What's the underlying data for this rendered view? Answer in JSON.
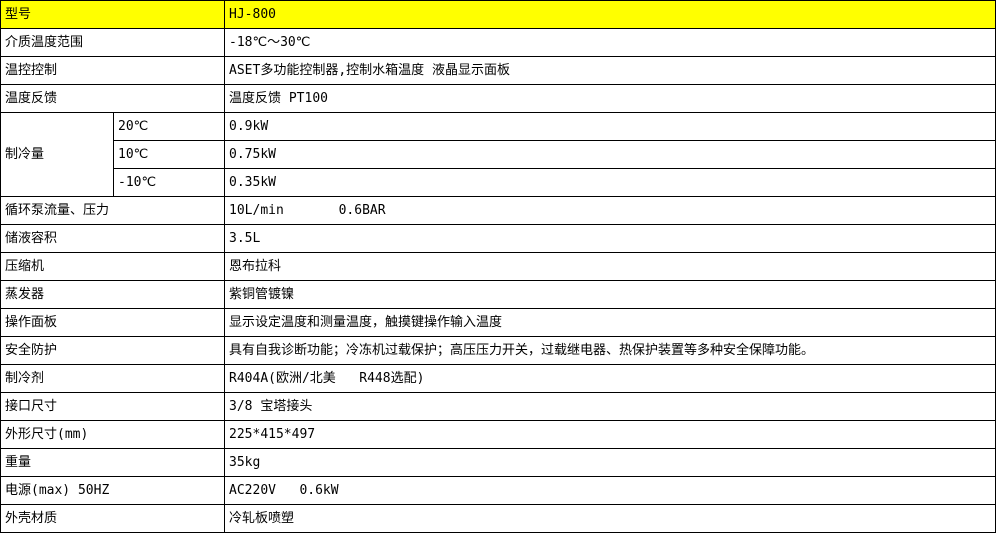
{
  "header": {
    "label": "型号",
    "value": "HJ-800"
  },
  "rows_before": [
    {
      "label": "介质温度范围",
      "value": "-18℃～30℃"
    },
    {
      "label": "温控控制",
      "value": "ASET多功能控制器,控制水箱温度 液晶显示面板"
    },
    {
      "label": "温度反馈",
      "value": "温度反馈 PT100"
    }
  ],
  "cooling": {
    "label": "制冷量",
    "items": [
      {
        "temp": "20℃",
        "value": "0.9kW"
      },
      {
        "temp": "10℃",
        "value": "0.75kW"
      },
      {
        "temp": "-10℃",
        "value": "0.35kW"
      }
    ]
  },
  "rows_after": [
    {
      "label": "循环泵流量、压力",
      "value": "10L/min       0.6BAR"
    },
    {
      "label": "储液容积",
      "value": "3.5L"
    },
    {
      "label": "压缩机",
      "value": "恩布拉科"
    },
    {
      "label": "蒸发器",
      "value": "紫铜管镀镍"
    },
    {
      "label": "操作面板",
      "value": "显示设定温度和测量温度，触摸键操作输入温度"
    },
    {
      "label": "安全防护",
      "value": "具有自我诊断功能；冷冻机过载保护；高压压力开关，过载继电器、热保护装置等多种安全保障功能。"
    },
    {
      "label": "制冷剂",
      "value": "R404A(欧洲/北美   R448选配)"
    },
    {
      "label": "接口尺寸",
      "value": "3/8 宝塔接头"
    },
    {
      "label": "外形尺寸(mm)",
      "value": "225*415*497"
    },
    {
      "label": "重量",
      "value": "35kg"
    },
    {
      "label": "电源(max) 50HZ",
      "value": "AC220V   0.6kW"
    },
    {
      "label": "外壳材质",
      "value": "冷轧板喷塑"
    }
  ]
}
